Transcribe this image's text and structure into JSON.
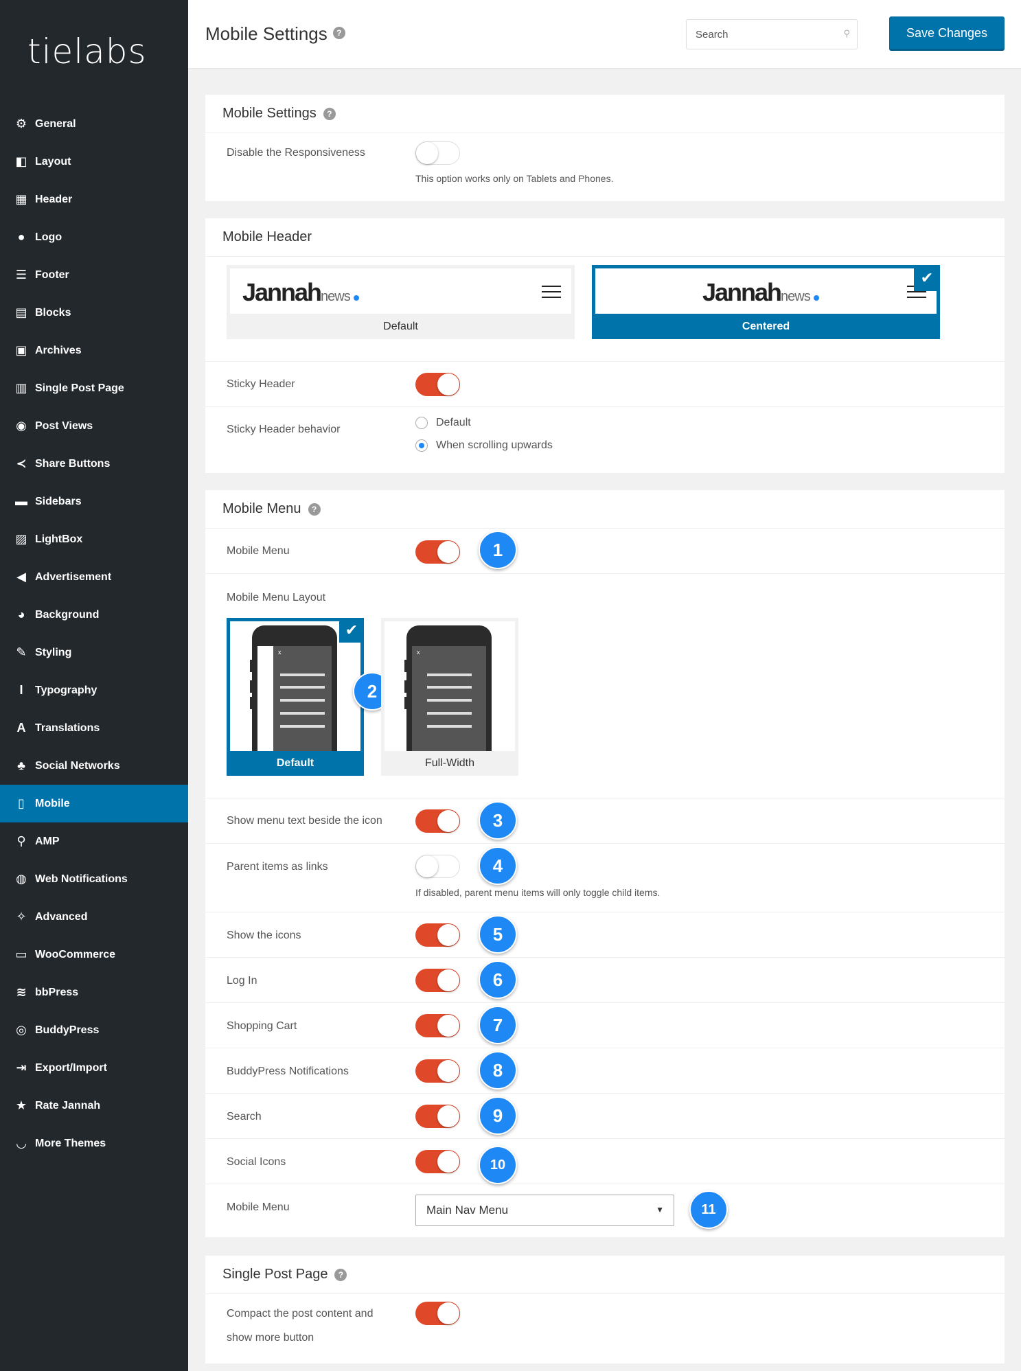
{
  "brand": {
    "logo_text": "tielabs"
  },
  "sidebar": {
    "items": [
      {
        "label": "General",
        "icon": "gear-icon",
        "glyph": "⚙"
      },
      {
        "label": "Layout",
        "icon": "layout-icon",
        "glyph": "◧"
      },
      {
        "label": "Header",
        "icon": "header-icon",
        "glyph": "▦"
      },
      {
        "label": "Logo",
        "icon": "lightbulb-icon",
        "glyph": "●"
      },
      {
        "label": "Footer",
        "icon": "footer-icon",
        "glyph": "☰"
      },
      {
        "label": "Blocks",
        "icon": "blocks-icon",
        "glyph": "▤"
      },
      {
        "label": "Archives",
        "icon": "archives-icon",
        "glyph": "▣"
      },
      {
        "label": "Single Post Page",
        "icon": "document-icon",
        "glyph": "▥"
      },
      {
        "label": "Post Views",
        "icon": "eye-icon",
        "glyph": "◉"
      },
      {
        "label": "Share Buttons",
        "icon": "share-icon",
        "glyph": "≺"
      },
      {
        "label": "Sidebars",
        "icon": "sidebars-icon",
        "glyph": "▬"
      },
      {
        "label": "LightBox",
        "icon": "image-icon",
        "glyph": "▨"
      },
      {
        "label": "Advertisement",
        "icon": "megaphone-icon",
        "glyph": "◀"
      },
      {
        "label": "Background",
        "icon": "palette-icon",
        "glyph": "◕"
      },
      {
        "label": "Styling",
        "icon": "brush-icon",
        "glyph": "✎"
      },
      {
        "label": "Typography",
        "icon": "italic-icon",
        "glyph": "I"
      },
      {
        "label": "Translations",
        "icon": "letter-a-icon",
        "glyph": "A"
      },
      {
        "label": "Social Networks",
        "icon": "sitemap-icon",
        "glyph": "♣"
      },
      {
        "label": "Mobile",
        "icon": "mobile-icon",
        "glyph": "▯"
      },
      {
        "label": "AMP",
        "icon": "search-icon",
        "glyph": "⚲"
      },
      {
        "label": "Web Notifications",
        "icon": "globe-icon",
        "glyph": "◍"
      },
      {
        "label": "Advanced",
        "icon": "wrench-icon",
        "glyph": "✧"
      },
      {
        "label": "WooCommerce",
        "icon": "woocommerce-icon",
        "glyph": "▭"
      },
      {
        "label": "bbPress",
        "icon": "bbpress-icon",
        "glyph": "≋"
      },
      {
        "label": "BuddyPress",
        "icon": "buddypress-icon",
        "glyph": "◎"
      },
      {
        "label": "Export/Import",
        "icon": "export-icon",
        "glyph": "⇥"
      },
      {
        "label": "Rate Jannah",
        "icon": "star-icon",
        "glyph": "★"
      },
      {
        "label": "More Themes",
        "icon": "smile-icon",
        "glyph": "◡"
      }
    ],
    "active_index": 18
  },
  "header": {
    "title": "Mobile Settings",
    "search_placeholder": "Search",
    "save_label": "Save Changes"
  },
  "panels": {
    "mobile_settings": {
      "title": "Mobile Settings",
      "disable_responsiveness_label": "Disable the Responsiveness",
      "disable_responsiveness_on": false,
      "disable_responsiveness_hint": "This option works only on Tablets and Phones."
    },
    "mobile_header": {
      "title": "Mobile Header",
      "brand_name": "Jannah",
      "brand_suffix": "news",
      "layout_default_label": "Default",
      "layout_centered_label": "Centered",
      "layout_selected": "Centered",
      "sticky_header_label": "Sticky Header",
      "sticky_header_on": true,
      "sticky_behavior_label": "Sticky Header behavior",
      "sticky_behavior_options": [
        "Default",
        "When scrolling upwards"
      ],
      "sticky_behavior_selected": "When scrolling upwards"
    },
    "mobile_menu": {
      "title": "Mobile Menu",
      "mobile_menu_label": "Mobile Menu",
      "layout_label": "Mobile Menu Layout",
      "layout_default_label": "Default",
      "layout_fullwidth_label": "Full-Width",
      "layout_selected": "Default",
      "show_text_label": "Show menu text beside the icon",
      "parent_links_label": "Parent items as links",
      "parent_links_on": false,
      "parent_links_hint": "If disabled, parent menu items will only toggle child items.",
      "show_icons_label": "Show the icons",
      "login_label": "Log In",
      "cart_label": "Shopping Cart",
      "bp_notifications_label": "BuddyPress Notifications",
      "search_label": "Search",
      "social_icons_label": "Social Icons",
      "menu_select_label": "Mobile Menu",
      "menu_select_value": "Main Nav Menu"
    },
    "single_post": {
      "title": "Single Post Page",
      "compact_label_line1": "Compact the post content and",
      "compact_label_line2": "show more button",
      "compact_on": true
    }
  },
  "callouts": [
    "1",
    "2",
    "3",
    "4",
    "5",
    "6",
    "7",
    "8",
    "9",
    "10",
    "11"
  ],
  "colors": {
    "sidebar_bg": "#23282d",
    "accent_blue": "#0073aa",
    "toggle_on": "#e0482a",
    "callout_blue": "#1e88f5"
  }
}
